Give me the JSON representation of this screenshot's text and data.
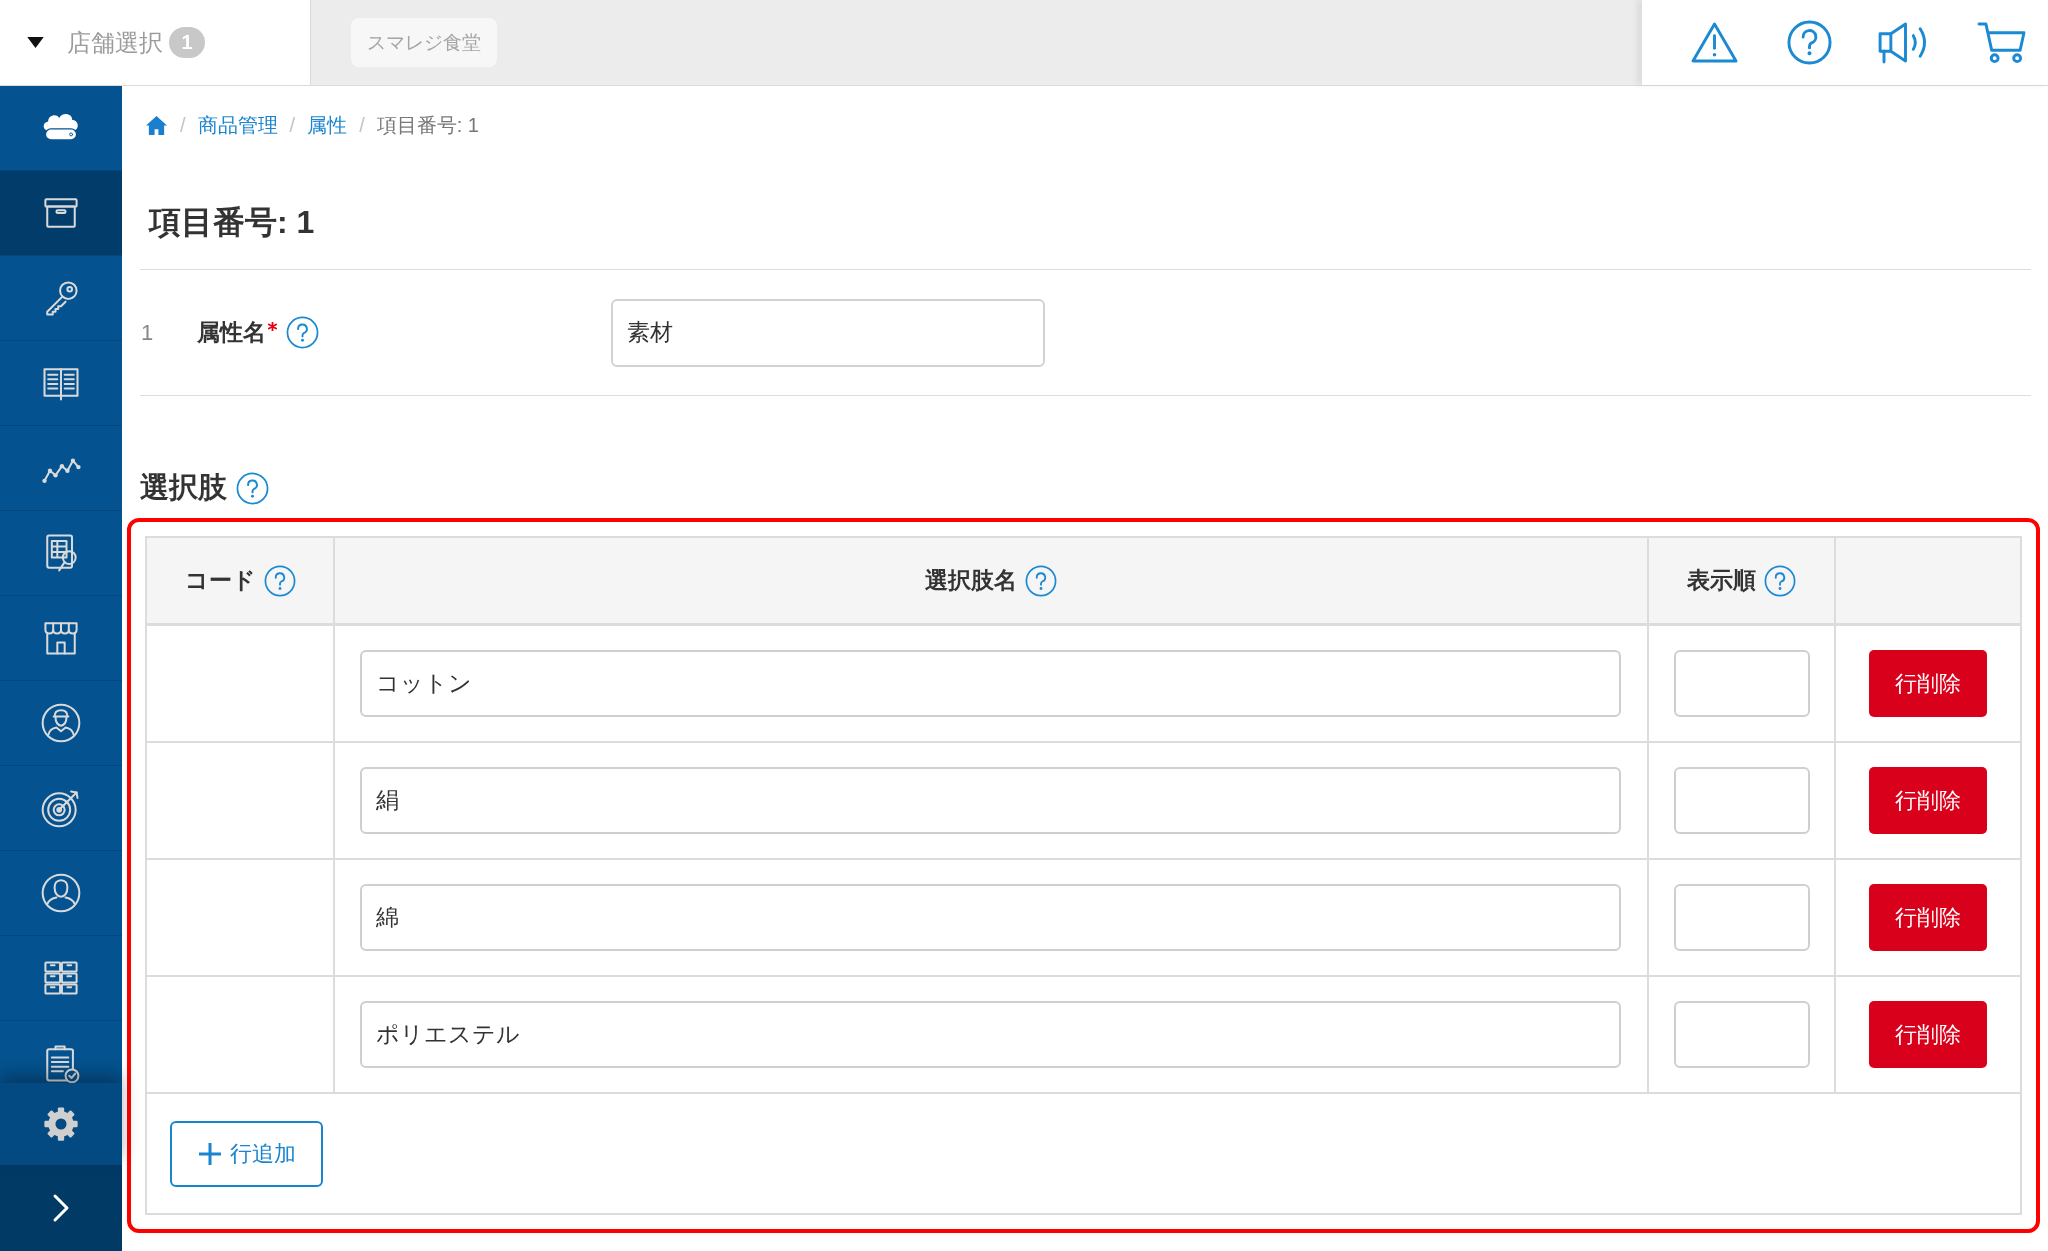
{
  "top_bar": {
    "store_selector": {
      "label": "店舗選択",
      "badge": "1"
    },
    "store_button": "スマレジ食堂"
  },
  "sidebar": {
    "items": [
      {
        "selected": false
      },
      {
        "selected": true
      },
      {
        "selected": false
      },
      {
        "selected": false
      },
      {
        "selected": false
      },
      {
        "selected": false
      },
      {
        "selected": false
      },
      {
        "selected": false
      },
      {
        "selected": false
      },
      {
        "selected": false
      },
      {
        "selected": false
      },
      {
        "selected": false
      }
    ]
  },
  "breadcrumb": [
    {
      "kind": "home"
    },
    {
      "kind": "separator",
      "text": "/"
    },
    {
      "kind": "link",
      "text": "商品管理"
    },
    {
      "kind": "separator",
      "text": "/"
    },
    {
      "kind": "link",
      "text": "属性"
    },
    {
      "kind": "separator",
      "text": "/"
    },
    {
      "kind": "current",
      "text": "項目番号: 1"
    }
  ],
  "title": "項目番号: 1",
  "fields": [
    {
      "number": "1",
      "label": "属性名",
      "required": true,
      "help": true,
      "value": "素材"
    }
  ],
  "options": {
    "heading": "選択肢",
    "help": true,
    "highlighted": true,
    "columns": [
      {
        "label": "コード",
        "help": true
      },
      {
        "label": "選択肢名",
        "help": true
      },
      {
        "label": "表示順",
        "help": true
      }
    ],
    "rows": [
      {
        "name": "コットン",
        "delete_label": "行削除"
      },
      {
        "name": "絹",
        "delete_label": "行削除"
      },
      {
        "name": "綿",
        "delete_label": "行削除"
      },
      {
        "name": "ポリエステル",
        "delete_label": "行削除"
      }
    ],
    "add_button": "行追加"
  }
}
